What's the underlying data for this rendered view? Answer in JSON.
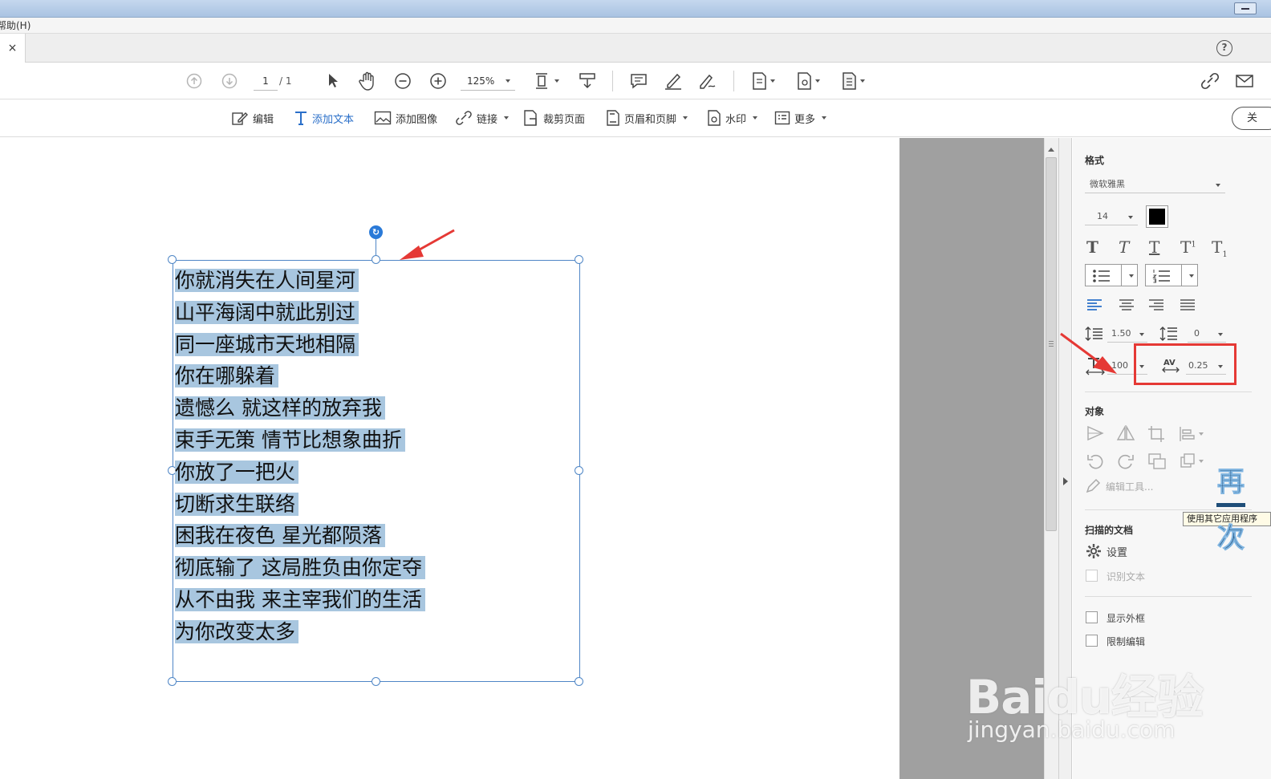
{
  "menubar": {
    "help_label": "帮助(H)"
  },
  "tabbar": {
    "close_label": "×",
    "help_icon": "?"
  },
  "toolbar_main": {
    "page_current": "1",
    "page_total": "/ 1",
    "zoom": "125%"
  },
  "toolbar_edit": {
    "edit": "编辑",
    "add_text": "添加文本",
    "add_image": "添加图像",
    "link": "链接",
    "crop": "裁剪页面",
    "header_footer": "页眉和页脚",
    "watermark": "水印",
    "more": "更多",
    "close": "关"
  },
  "panel": {
    "format_title": "格式",
    "font_name": "微软雅黑",
    "font_size": "14",
    "text_color": "#000000",
    "line_spacing": "1.50",
    "para_spacing": "0",
    "horizontal_scale": "100",
    "char_spacing": "0.25",
    "object_title": "对象",
    "edit_tools": "编辑工具...",
    "scanned_title": "扫描的文档",
    "settings": "设置",
    "recognize_text": "识别文本",
    "show_bbox": "显示外框",
    "restrict_edit": "限制编辑",
    "tooltip": "使用其它应用程序"
  },
  "document": {
    "lines": [
      "你就消失在人间星河",
      "山平海阔中就此别过",
      "同一座城市天地相隔",
      "你在哪躲着",
      "遗憾么 就这样的放弃我",
      "束手无策 情节比想象曲折",
      "你放了一把火",
      "切断求生联络",
      "困我在夜色 星光都陨落",
      "彻底输了 这局胜负由你定夺",
      "从不由我 来主宰我们的生活",
      "为你改变太多"
    ]
  },
  "watermark": {
    "logo": "Baidu经验",
    "url": "jingyan.baidu.com"
  },
  "stamp": {
    "chars": "再一次"
  },
  "colors": {
    "accent": "#2a6fc9",
    "highlight": "#a8c6df",
    "annotation": "#e53935"
  }
}
